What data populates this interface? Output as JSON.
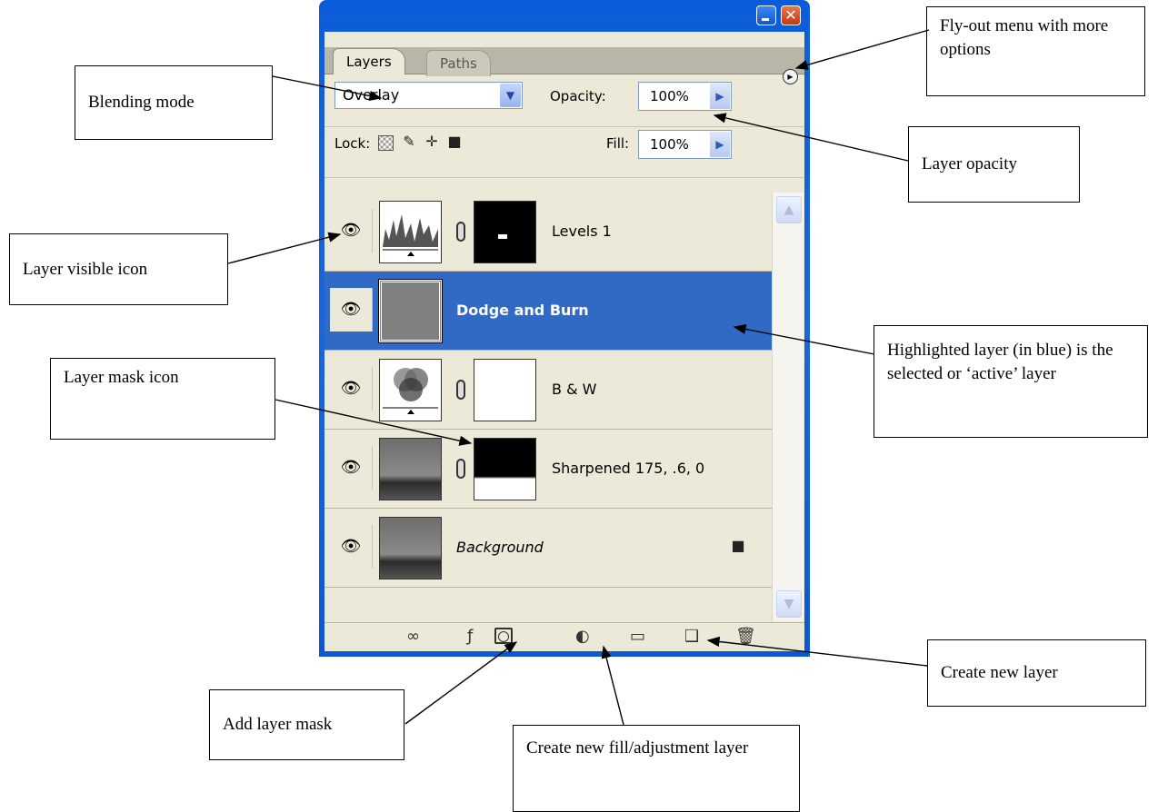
{
  "panel": {
    "tabs": [
      "Layers",
      "Paths"
    ],
    "blend_mode": "Overlay",
    "opacity_label": "Opacity:",
    "opacity_value": "100%",
    "lock_label": "Lock:",
    "fill_label": "Fill:",
    "fill_value": "100%",
    "layers": [
      {
        "name": "Levels 1",
        "selected": false
      },
      {
        "name": "Dodge and Burn",
        "selected": true
      },
      {
        "name": "B & W",
        "selected": false
      },
      {
        "name": "Sharpened 175, .6, 0",
        "selected": false
      },
      {
        "name": "Background",
        "selected": false,
        "locked": true
      }
    ],
    "toolbar_icons": [
      "link-icon",
      "layer-style-icon",
      "add-mask-icon",
      "adjustment-layer-icon",
      "group-folder-icon",
      "new-layer-icon",
      "trash-icon"
    ]
  },
  "callouts": {
    "flyout": "Fly-out menu with more options",
    "blending": "Blending mode",
    "opacity": "Layer opacity",
    "visible": "Layer visible icon",
    "mask_icon": "Layer mask icon",
    "highlighted": "Highlighted layer (in blue) is the selected or ‘active’ layer",
    "new_layer": "Create new layer",
    "add_mask": "Add layer mask",
    "fill_adj": "Create new fill/adjustment layer"
  },
  "colors": {
    "selection": "#316ac5",
    "panel_bg": "#ece9d8",
    "title_bar": "#0c58d0"
  }
}
